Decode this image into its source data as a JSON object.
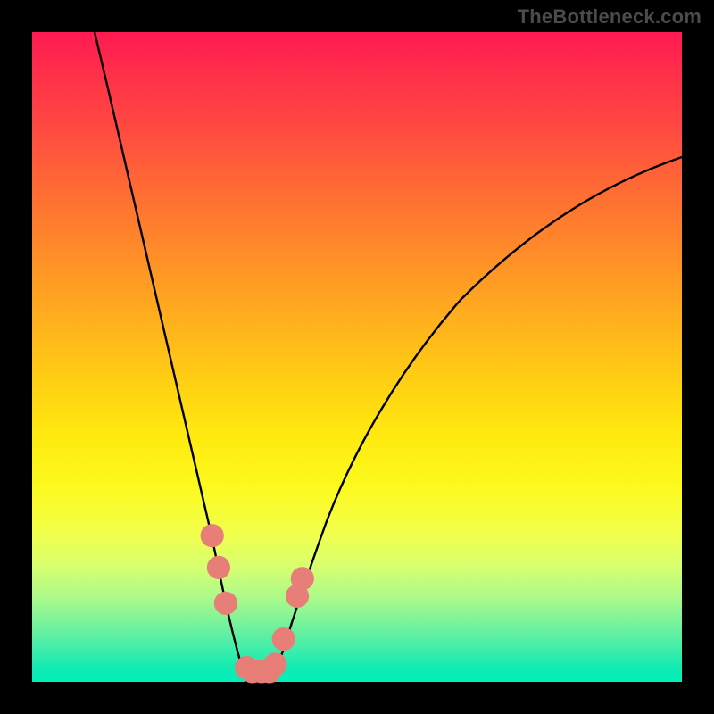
{
  "attribution": "TheBottleneck.com",
  "chart_data": {
    "type": "line",
    "title": "",
    "xlabel": "",
    "ylabel": "",
    "xlim": [
      0,
      100
    ],
    "ylim": [
      0,
      100
    ],
    "series": [
      {
        "name": "left-branch",
        "x": [
          9.6,
          12.4,
          15.1,
          17.9,
          20.6,
          23.3,
          25.4,
          27.5,
          28.8,
          30.2,
          31.2,
          33.0
        ],
        "values": [
          100,
          88.5,
          77.0,
          65.4,
          53.8,
          42.3,
          32.4,
          22.5,
          16.5,
          9.9,
          5.5,
          0.0
        ]
      },
      {
        "name": "right-branch",
        "x": [
          37.1,
          38.5,
          40.0,
          41.2,
          43.3,
          45.3,
          48.1,
          52.2,
          56.3,
          61.8,
          68.7,
          79.7,
          89.3,
          100.0
        ],
        "values": [
          0.0,
          4.4,
          9.9,
          13.2,
          19.2,
          24.2,
          30.2,
          37.9,
          44.5,
          51.6,
          59.3,
          68.7,
          74.7,
          80.8
        ]
      }
    ],
    "markers": [
      {
        "x": 27.7,
        "y": 22.5
      },
      {
        "x": 28.7,
        "y": 17.6
      },
      {
        "x": 29.8,
        "y": 12.1
      },
      {
        "x": 33.0,
        "y": 2.2
      },
      {
        "x": 33.9,
        "y": 1.6
      },
      {
        "x": 35.3,
        "y": 1.6
      },
      {
        "x": 36.5,
        "y": 1.6
      },
      {
        "x": 37.4,
        "y": 2.7
      },
      {
        "x": 38.7,
        "y": 6.6
      },
      {
        "x": 40.8,
        "y": 13.2
      },
      {
        "x": 41.6,
        "y": 15.9
      }
    ],
    "marker_radius_percent": 1.8
  }
}
